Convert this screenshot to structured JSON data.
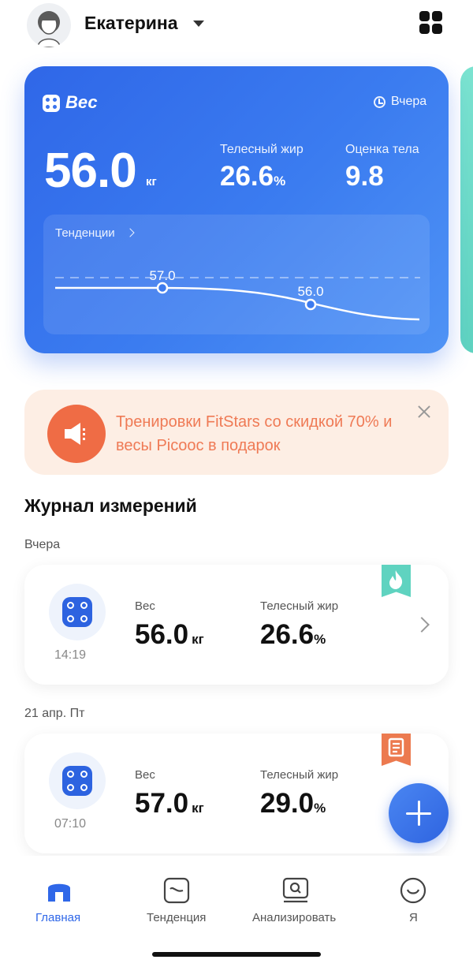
{
  "header": {
    "user_name": "Екатерина"
  },
  "weight_card": {
    "title": "Вес",
    "time": "Вчера",
    "weight_value": "56.0",
    "weight_unit": "кг",
    "fat_label": "Телесный жир",
    "fat_value": "26.6",
    "fat_unit": "%",
    "score_label": "Оценка тела",
    "score_value": "9.8",
    "trend_label": "Тенденции",
    "trend_point_1": "57.0",
    "trend_point_2": "56.0"
  },
  "promo": {
    "text": "Тренировки FitStars со скидкой 70% и весы Picooc в подарок"
  },
  "journal": {
    "title": "Журнал измерений",
    "groups": [
      {
        "date": "Вчера",
        "entry": {
          "time": "14:19",
          "weight_label": "Вес",
          "weight_value": "56.0",
          "weight_unit": "кг",
          "fat_label": "Телесный жир",
          "fat_value": "26.6",
          "fat_unit": "%",
          "badge": "flame-icon"
        }
      },
      {
        "date": "21 апр. Пт",
        "entry": {
          "time": "07:10",
          "weight_label": "Вес",
          "weight_value": "57.0",
          "weight_unit": "кг",
          "fat_label": "Телесный жир",
          "fat_value": "29.0",
          "fat_unit": "%",
          "badge": "report-icon"
        }
      }
    ]
  },
  "nav": {
    "items": [
      {
        "label": "Главная",
        "icon": "home-icon",
        "active": true
      },
      {
        "label": "Тенденция",
        "icon": "trend-icon",
        "active": false
      },
      {
        "label": "Анализировать",
        "icon": "analyze-icon",
        "active": false
      },
      {
        "label": "Я",
        "icon": "profile-icon",
        "active": false
      }
    ]
  },
  "colors": {
    "accent": "#2f67e8",
    "promo_bg": "#fdeee4",
    "promo_accent": "#ef6c45",
    "badge_teal": "#5fd3c0",
    "badge_orange": "#ec7a4f"
  }
}
